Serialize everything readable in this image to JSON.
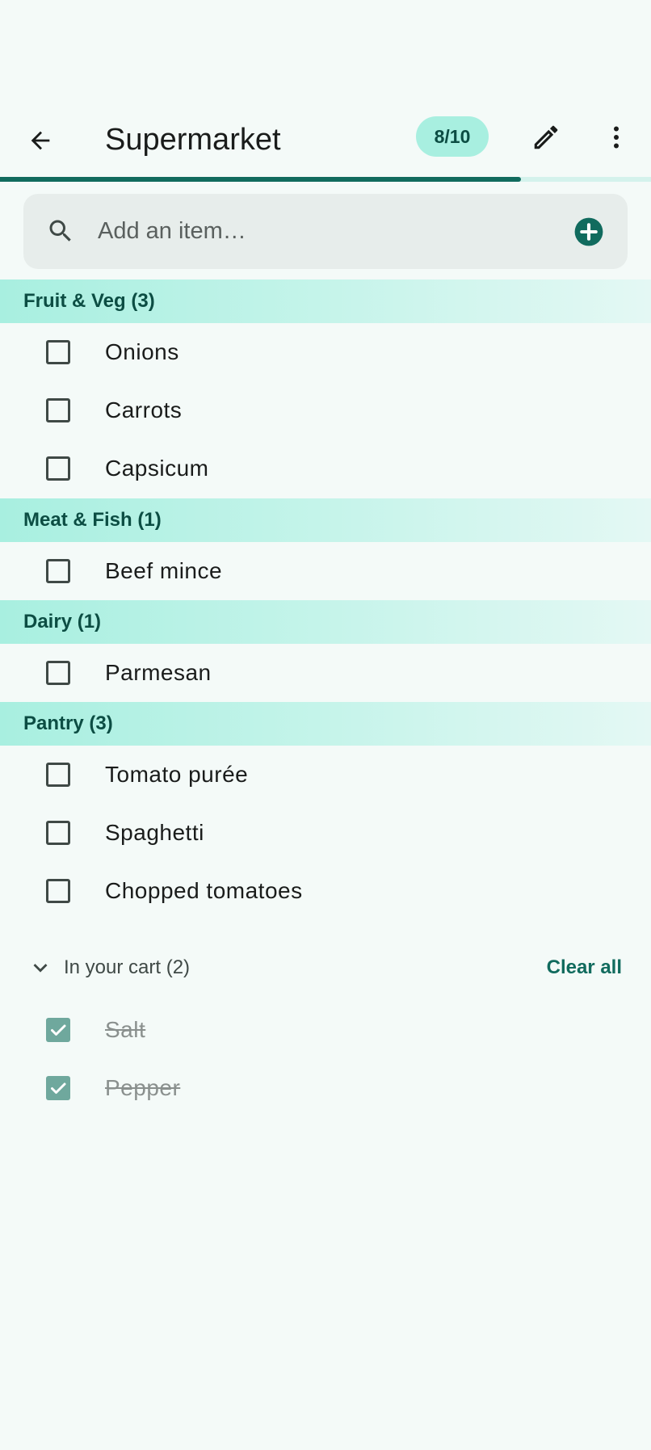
{
  "appbar": {
    "title": "Supermarket",
    "progress_label": "8/10",
    "progress_fraction": 0.8
  },
  "search": {
    "placeholder": "Add an item…",
    "value": ""
  },
  "sections": [
    {
      "header": "Fruit & Veg (3)",
      "items": [
        "Onions",
        "Carrots",
        "Capsicum"
      ]
    },
    {
      "header": "Meat & Fish (1)",
      "items": [
        "Beef mince"
      ]
    },
    {
      "header": "Dairy (1)",
      "items": [
        "Parmesan"
      ]
    },
    {
      "header": "Pantry (3)",
      "items": [
        "Tomato purée",
        "Spaghetti",
        "Chopped tomatoes"
      ]
    }
  ],
  "cart": {
    "label": "In your cart (2)",
    "clear_label": "Clear all",
    "items": [
      "Salt",
      "Pepper"
    ]
  },
  "colors": {
    "primary": "#116b5e",
    "section_header": "#a8efe0",
    "background": "#f4faf8",
    "checked_box": "#6fa89d"
  },
  "icons": {
    "back": "arrow-left-icon",
    "edit": "pencil-icon",
    "more": "more-vert-icon",
    "search": "search-icon",
    "add": "add-circle-icon",
    "cart_toggle": "chevron-down-icon"
  }
}
